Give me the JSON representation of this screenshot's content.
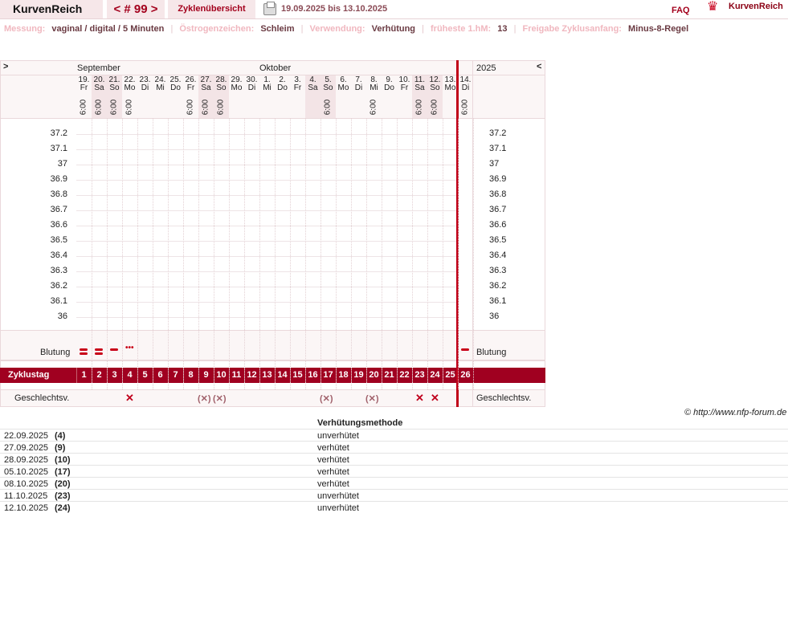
{
  "header": {
    "app_title": "KurvenReich",
    "cycle_nav": "< # 99 >",
    "cycle_overview": "Zyklenübersicht",
    "date_range": "19.09.2025 bis 13.10.2025",
    "faq": "FAQ",
    "logo_text": "KurvenReich",
    "icons": [
      "printer-icon",
      "crown-logo-icon"
    ]
  },
  "info": {
    "messung_label": "Messung:",
    "messung_value": "vaginal / digital / 5 Minuten",
    "oestrogen_label": "Östrogenzeichen:",
    "oestrogen_value": "Schleim",
    "verwendung_label": "Verwendung:",
    "verwendung_value": "Verhütung",
    "hm_label": "früheste 1.hM:",
    "hm_value": "13",
    "freigabe_label": "Freigabe Zyklusanfang:",
    "freigabe_value": "Minus-8-Regel"
  },
  "grid": {
    "nav_left": ">",
    "nav_right": "<",
    "month1": "September",
    "month2": "Oktober",
    "year": "2025",
    "days": [
      {
        "d": "19.",
        "w": "Fr",
        "t": "6:00",
        "shade": false
      },
      {
        "d": "20.",
        "w": "Sa",
        "t": "6:00",
        "shade": true
      },
      {
        "d": "21.",
        "w": "So",
        "t": "6:00",
        "shade": true
      },
      {
        "d": "22.",
        "w": "Mo",
        "t": "6:00",
        "shade": false
      },
      {
        "d": "23.",
        "w": "Di",
        "t": "",
        "shade": false
      },
      {
        "d": "24.",
        "w": "Mi",
        "t": "",
        "shade": false
      },
      {
        "d": "25.",
        "w": "Do",
        "t": "",
        "shade": false
      },
      {
        "d": "26.",
        "w": "Fr",
        "t": "6:00",
        "shade": false
      },
      {
        "d": "27.",
        "w": "Sa",
        "t": "6:00",
        "shade": true
      },
      {
        "d": "28.",
        "w": "So",
        "t": "6:00",
        "shade": true
      },
      {
        "d": "29.",
        "w": "Mo",
        "t": "",
        "shade": false
      },
      {
        "d": "30.",
        "w": "Di",
        "t": "",
        "shade": false
      },
      {
        "d": "1.",
        "w": "Mi",
        "t": "",
        "shade": false
      },
      {
        "d": "2.",
        "w": "Do",
        "t": "",
        "shade": false
      },
      {
        "d": "3.",
        "w": "Fr",
        "t": "",
        "shade": false
      },
      {
        "d": "4.",
        "w": "Sa",
        "t": "",
        "shade": true
      },
      {
        "d": "5.",
        "w": "So",
        "t": "6:00",
        "shade": true
      },
      {
        "d": "6.",
        "w": "Mo",
        "t": "",
        "shade": false
      },
      {
        "d": "7.",
        "w": "Di",
        "t": "",
        "shade": false
      },
      {
        "d": "8.",
        "w": "Mi",
        "t": "6:00",
        "shade": false
      },
      {
        "d": "9.",
        "w": "Do",
        "t": "",
        "shade": false
      },
      {
        "d": "10.",
        "w": "Fr",
        "t": "",
        "shade": false
      },
      {
        "d": "11.",
        "w": "Sa",
        "t": "6:00",
        "shade": true
      },
      {
        "d": "12.",
        "w": "So",
        "t": "6:00",
        "shade": true
      },
      {
        "d": "13.",
        "w": "Mo",
        "t": "",
        "shade": false
      },
      {
        "d": "14.",
        "w": "Di",
        "t": "6:00",
        "shade": false
      }
    ],
    "temps": [
      "37.2",
      "37.1",
      "37",
      "36.9",
      "36.8",
      "36.7",
      "36.6",
      "36.5",
      "36.4",
      "36.3",
      "36.2",
      "36.1",
      "36"
    ],
    "blutung_label": "Blutung",
    "bleeding": [
      {
        "day": 1,
        "type": "heavy"
      },
      {
        "day": 2,
        "type": "heavy"
      },
      {
        "day": 3,
        "type": "medium"
      },
      {
        "day": 4,
        "type": "spotting"
      },
      {
        "day": 26,
        "type": "medium"
      }
    ],
    "zyklustag_label": "Zyklustag",
    "cycle_days": [
      "1",
      "2",
      "3",
      "4",
      "5",
      "6",
      "7",
      "8",
      "9",
      "10",
      "11",
      "12",
      "13",
      "14",
      "15",
      "16",
      "17",
      "18",
      "19",
      "20",
      "21",
      "22",
      "23",
      "24",
      "25",
      "26"
    ],
    "gv_label": "Geschlechtsv.",
    "gv_marks": [
      {
        "day": 4,
        "mark": "✕"
      },
      {
        "day": 9,
        "mark": "(✕)"
      },
      {
        "day": 10,
        "mark": "(✕)"
      },
      {
        "day": 17,
        "mark": "(✕)"
      },
      {
        "day": 20,
        "mark": "(✕)"
      },
      {
        "day": 23,
        "mark": "✕"
      },
      {
        "day": 24,
        "mark": "✕"
      }
    ]
  },
  "copyright": "© http://www.nfp-forum.de",
  "methods": {
    "header": "Verhütungsmethode",
    "rows": [
      {
        "date": "22.09.2025",
        "day": "(4)",
        "method": "unverhütet"
      },
      {
        "date": "27.09.2025",
        "day": "(9)",
        "method": "verhütet"
      },
      {
        "date": "28.09.2025",
        "day": "(10)",
        "method": "verhütet"
      },
      {
        "date": "05.10.2025",
        "day": "(17)",
        "method": "verhütet"
      },
      {
        "date": "08.10.2025",
        "day": "(20)",
        "method": "verhütet"
      },
      {
        "date": "11.10.2025",
        "day": "(23)",
        "method": "unverhütet"
      },
      {
        "date": "12.10.2025",
        "day": "(24)",
        "method": "unverhütet"
      }
    ]
  }
}
